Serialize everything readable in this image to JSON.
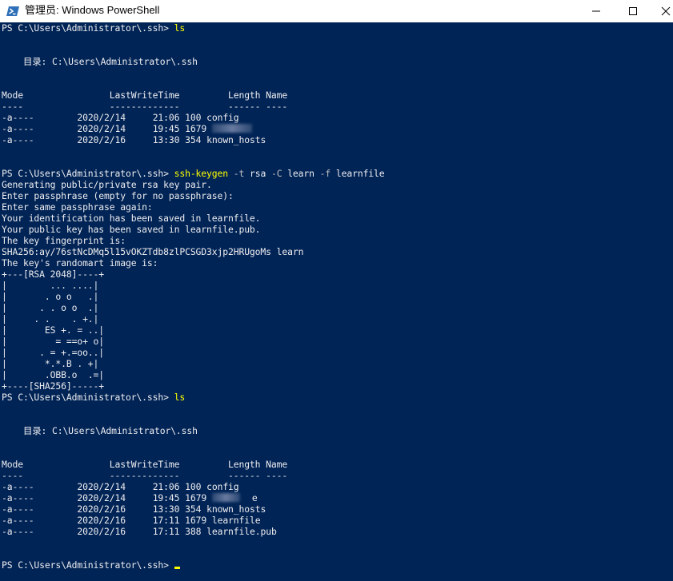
{
  "window": {
    "title": "管理员: Windows PowerShell",
    "colors": {
      "background": "#012456",
      "foreground": "#eeedf0",
      "command": "#ffff00",
      "parameter": "#c0c0c0",
      "cursor": "#ffff00"
    }
  },
  "console": {
    "prompt": "PS C:\\Users\\Administrator\\.ssh> ",
    "ls_cmd": "ls",
    "dir_label": "    目录: C:\\Users\\Administrator\\.ssh",
    "header1": "Mode                LastWriteTime         Length Name",
    "header2": "----                -------------         ------ ----",
    "listing1": [
      {
        "mode": "-a----",
        "date": "2020/2/14",
        "time": "21:06",
        "length": "100",
        "name": "config"
      },
      {
        "mode": "-a----",
        "date": "2020/2/14",
        "time": "19:45",
        "length": "1679",
        "name": ""
      },
      {
        "mode": "-a----",
        "date": "2020/2/16",
        "time": "13:30",
        "length": "354",
        "name": "known_hosts"
      }
    ],
    "keygen": {
      "command": "ssh-keygen",
      "args": [
        {
          "flag": "-t",
          "value": "rsa"
        },
        {
          "flag": "-C",
          "value": "learn"
        },
        {
          "flag": "-f",
          "value": "learnfile"
        }
      ]
    },
    "keygen_output": [
      "Generating public/private rsa key pair.",
      "Enter passphrase (empty for no passphrase):",
      "Enter same passphrase again:",
      "Your identification has been saved in learnfile.",
      "Your public key has been saved in learnfile.pub.",
      "The key fingerprint is:",
      "SHA256:ay/76stNcDMq5l15vOKZTdb8zlPCSGD3xjp2HRUgoMs learn",
      "The key's randomart image is:"
    ],
    "randomart": [
      "+---[RSA 2048]----+",
      "|        ... ....|",
      "|       . o o   .|",
      "|      . . o o  .|",
      "|     . .    . +.|",
      "|       ES +. = ..|",
      "|         = ==o+ o|",
      "|      . = +.=oo..|",
      "|       *.*.B . +|",
      "|       .OBB.o  .=|",
      "+----[SHA256]-----+"
    ],
    "listing2": [
      {
        "mode": "-a----",
        "date": "2020/2/14",
        "time": "21:06",
        "length": "100",
        "name": "config"
      },
      {
        "mode": "-a----",
        "date": "2020/2/14",
        "time": "19:45",
        "length": "1679",
        "name": "e"
      },
      {
        "mode": "-a----",
        "date": "2020/2/16",
        "time": "13:30",
        "length": "354",
        "name": "known_hosts"
      },
      {
        "mode": "-a----",
        "date": "2020/2/16",
        "time": "17:11",
        "length": "1679",
        "name": "learnfile"
      },
      {
        "mode": "-a----",
        "date": "2020/2/16",
        "time": "17:11",
        "length": "388",
        "name": "learnfile.pub"
      }
    ]
  }
}
